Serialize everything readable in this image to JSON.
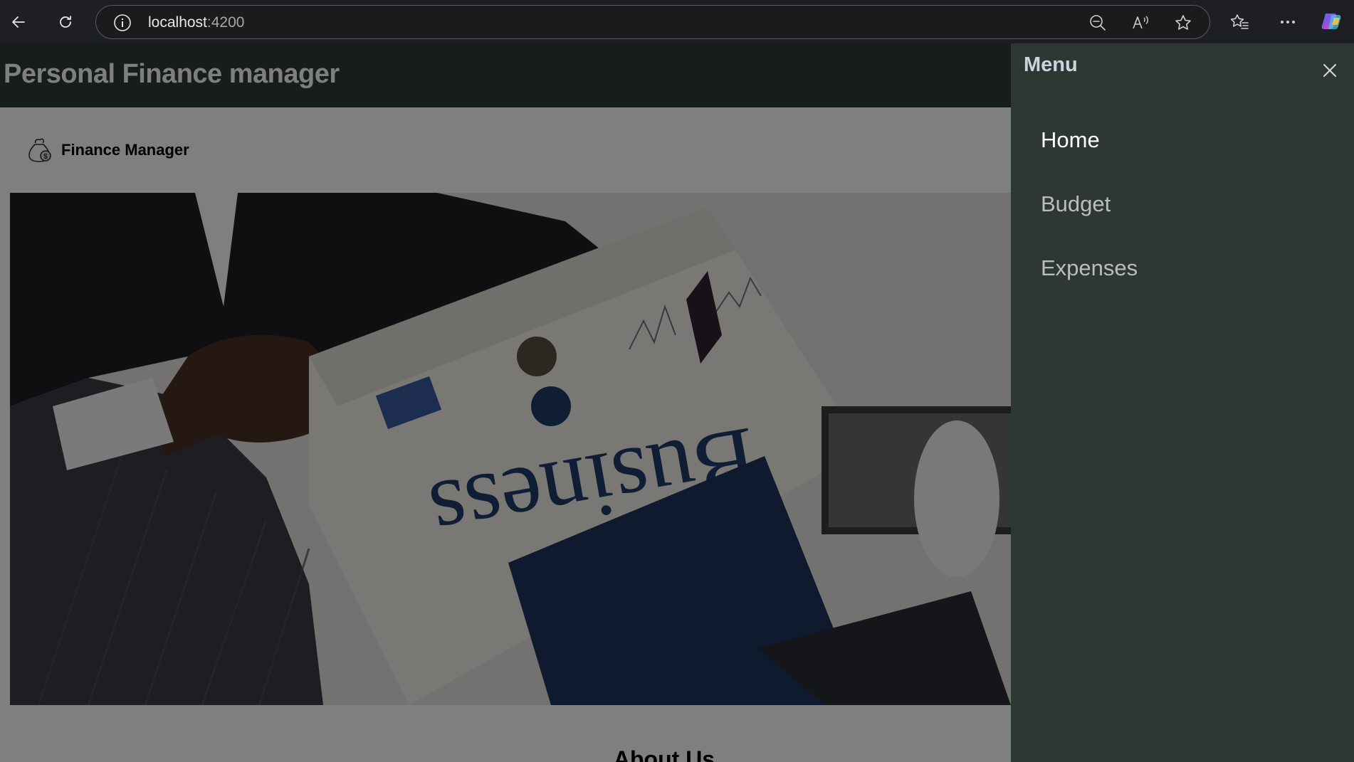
{
  "browser": {
    "url_host": "localhost",
    "url_port": ":4200",
    "icons": [
      "back-icon",
      "refresh-icon",
      "info-icon",
      "zoom-out-icon",
      "read-aloud-icon",
      "favorite-star-icon",
      "favorites-list-icon",
      "more-icon",
      "copilot-icon"
    ]
  },
  "header": {
    "title": "Personal Finance manager"
  },
  "brand": {
    "label": "Finance Manager",
    "icon": "money-bag-icon"
  },
  "hero": {
    "newspaper_word": "Business"
  },
  "about": {
    "heading": "About Us"
  },
  "menu": {
    "title": "Menu",
    "close_icon": "close-icon",
    "items": [
      {
        "label": "Home",
        "active": true
      },
      {
        "label": "Budget",
        "active": false
      },
      {
        "label": "Expenses",
        "active": false
      }
    ]
  },
  "colors": {
    "header_bg": "#2e3a33",
    "menu_bg": "#2e3833",
    "overlay": "rgba(0,0,0,0.5)"
  }
}
